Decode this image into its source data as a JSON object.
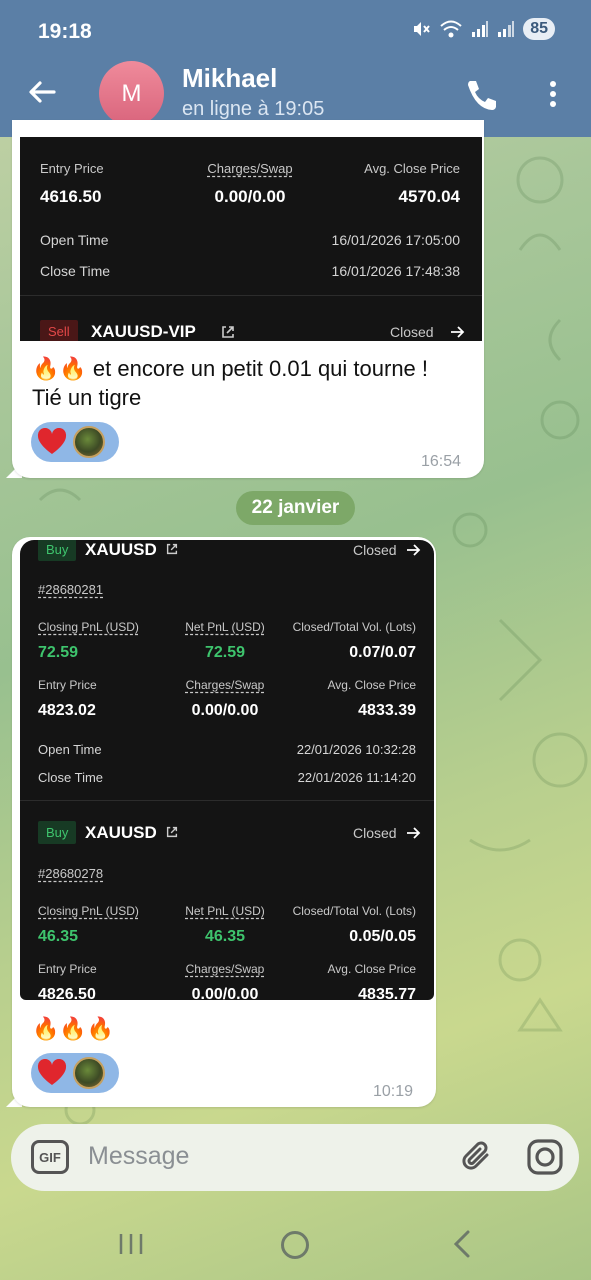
{
  "status_bar": {
    "time": "19:18",
    "battery": "85"
  },
  "header": {
    "avatar_letter": "M",
    "name": "Mikhael",
    "status": "en ligne à 19:05"
  },
  "message1": {
    "trade_partial": {
      "labels": {
        "entry_price": "Entry Price",
        "charges_swap": "Charges/Swap",
        "avg_close_price": "Avg. Close Price",
        "open_time": "Open Time",
        "close_time": "Close Time"
      },
      "entry_price": "4616.50",
      "charges_swap": "0.00/0.00",
      "avg_close_price": "4570.04",
      "open_time": "16/01/2026 17:05:00",
      "close_time": "16/01/2026 17:48:38"
    },
    "next_trade": {
      "side": "Sell",
      "symbol": "XAUUSD-VIP",
      "status": "Closed"
    },
    "text_line1": "🔥🔥 et encore un petit 0.01 qui tourne !",
    "text_line2": "Tié un tigre",
    "time": "16:54"
  },
  "date_separator": "22 janvier",
  "message2": {
    "trades": [
      {
        "side": "Buy",
        "symbol": "XAUUSD",
        "status": "Closed",
        "id": "#28680281",
        "labels": {
          "closing_pnl": "Closing PnL (USD)",
          "net_pnl": "Net PnL (USD)",
          "closed_total_vol": "Closed/Total Vol. (Lots)",
          "entry_price": "Entry Price",
          "charges_swap": "Charges/Swap",
          "avg_close_price": "Avg. Close Price",
          "open_time": "Open Time",
          "close_time": "Close Time"
        },
        "closing_pnl": "72.59",
        "net_pnl": "72.59",
        "closed_total_vol": "0.07/0.07",
        "entry_price": "4823.02",
        "charges_swap": "0.00/0.00",
        "avg_close_price": "4833.39",
        "open_time": "22/01/2026 10:32:28",
        "close_time": "22/01/2026 11:14:20"
      },
      {
        "side": "Buy",
        "symbol": "XAUUSD",
        "status": "Closed",
        "id": "#28680278",
        "labels": {
          "closing_pnl": "Closing PnL (USD)",
          "net_pnl": "Net PnL (USD)",
          "closed_total_vol": "Closed/Total Vol. (Lots)",
          "entry_price": "Entry Price",
          "charges_swap": "Charges/Swap",
          "avg_close_price": "Avg. Close Price"
        },
        "closing_pnl": "46.35",
        "net_pnl": "46.35",
        "closed_total_vol": "0.05/0.05",
        "entry_price": "4826.50",
        "charges_swap": "0.00/0.00",
        "avg_close_price": "4835.77"
      }
    ],
    "text": "🔥🔥🔥",
    "time": "10:19"
  },
  "input": {
    "gif_label": "GIF",
    "placeholder": "Message"
  },
  "colors": {
    "header": "#5b7fa6",
    "pnl_green": "#3ec46d",
    "buy_tag": "#173a24",
    "sell_tag": "#4a1717",
    "reaction_bg": "#8fb7e6"
  },
  "icons": [
    "back-arrow-icon",
    "phone-icon",
    "more-vert-icon",
    "external-link-icon",
    "arrow-right-icon",
    "heart-icon",
    "attach-icon",
    "camera-icon",
    "nav-recent-icon",
    "nav-home-icon",
    "nav-back-icon"
  ]
}
